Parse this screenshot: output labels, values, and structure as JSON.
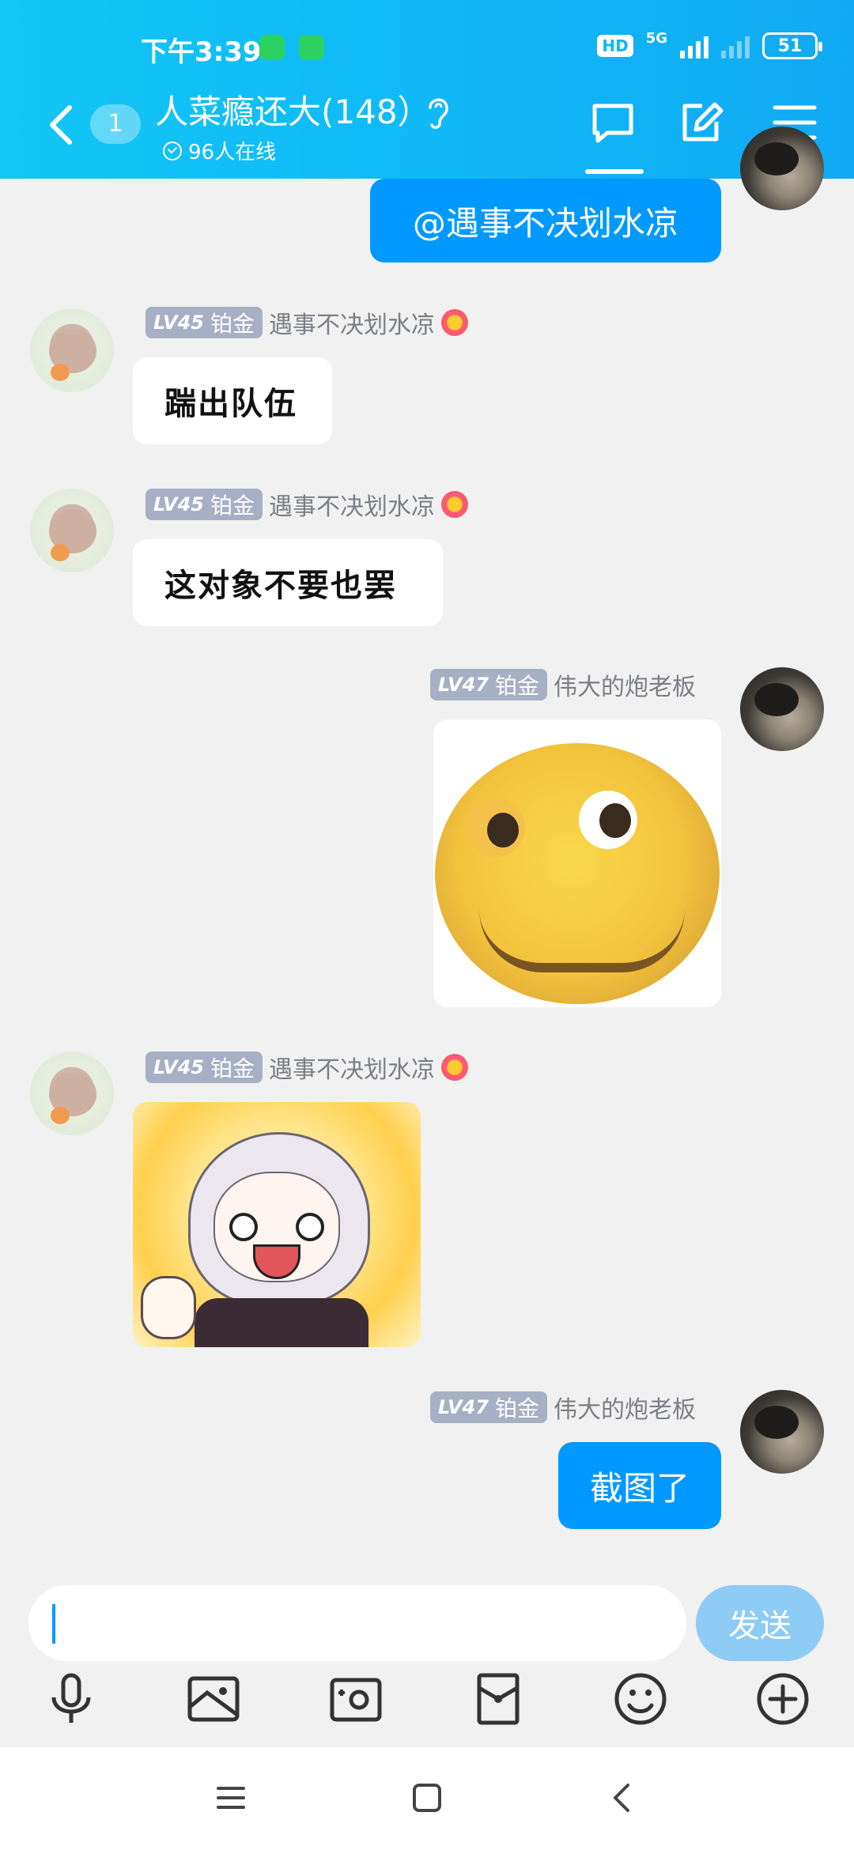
{
  "status_bar": {
    "time": "下午3:39",
    "hd": "HD",
    "network": "5G",
    "battery": "51"
  },
  "header": {
    "unread_count": "1",
    "group_title": "人菜瘾还大(148）",
    "online": "96人在线"
  },
  "messages": [
    {
      "type": "text",
      "side": "right",
      "text": "@遇事不决划水凉"
    },
    {
      "type": "text",
      "side": "left",
      "lv": "LV45",
      "rank": "铂金",
      "sender": "遇事不决划水凉",
      "text": "踹出队伍"
    },
    {
      "type": "text",
      "side": "left",
      "lv": "LV45",
      "rank": "铂金",
      "sender": "遇事不决划水凉",
      "text": "这对象不要也罢"
    },
    {
      "type": "image",
      "side": "right",
      "lv": "LV47",
      "rank": "铂金",
      "sender": "伟大的炮老板"
    },
    {
      "type": "image",
      "side": "left",
      "lv": "LV45",
      "rank": "铂金",
      "sender": "遇事不决划水凉"
    },
    {
      "type": "text",
      "side": "right",
      "lv": "LV47",
      "rank": "铂金",
      "sender": "伟大的炮老板",
      "text": "截图了"
    }
  ],
  "input": {
    "placeholder": "",
    "send_label": "发送"
  },
  "toolbar": {
    "icons": [
      "microphone-icon",
      "image-icon",
      "camera-icon",
      "red-packet-icon",
      "emoji-icon",
      "plus-icon"
    ]
  },
  "colors": {
    "header_gradient_start": "#12c6f5",
    "accent_blue": "#0099ff",
    "level_badge": "#a7afc4",
    "background": "#f1f1f1"
  }
}
